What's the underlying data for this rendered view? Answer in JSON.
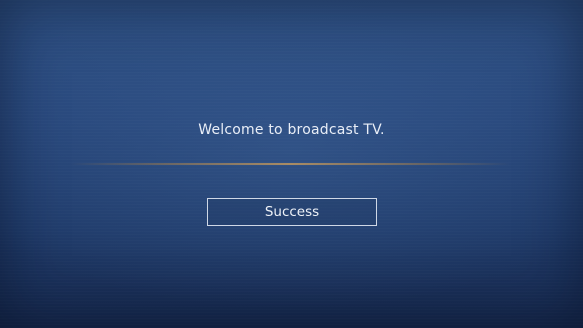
{
  "dialog": {
    "message": "Welcome to broadcast TV.",
    "button_label": "Success"
  },
  "colors": {
    "background_top": "#2e5083",
    "background_bottom": "#16284c",
    "text": "#e9eef7",
    "divider": "#be965f",
    "button_border": "#cfd8e6"
  }
}
